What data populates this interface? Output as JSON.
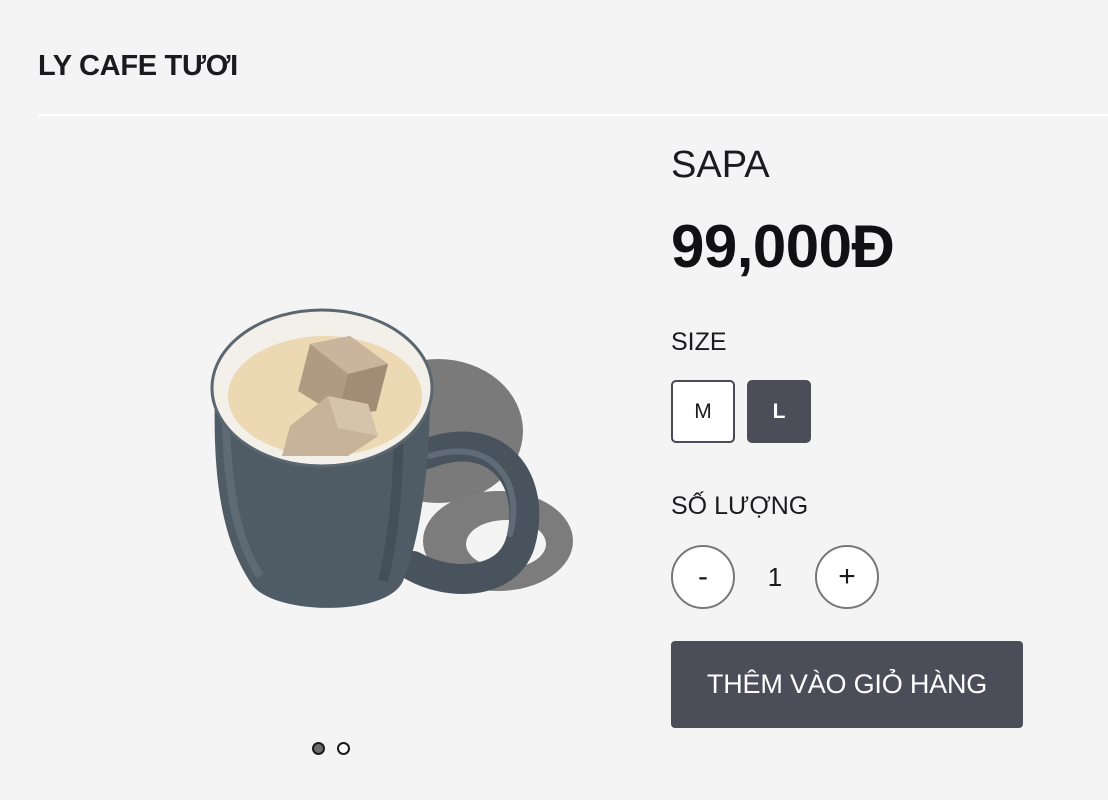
{
  "header": {
    "title": "LY CAFE TƯƠI"
  },
  "gallery": {
    "image_subject": "iced-coffee-in-gray-mug",
    "slide_count": 2,
    "active_slide": 1
  },
  "product": {
    "name": "SAPA",
    "price": "99,000Đ"
  },
  "size": {
    "label": "SIZE",
    "options": [
      "M",
      "L"
    ],
    "selected": "L"
  },
  "quantity": {
    "label": "SỐ LƯỢNG",
    "decrement_label": "-",
    "increment_label": "+",
    "value": "1"
  },
  "cart": {
    "add_label": "THÊM VÀO GIỎ HÀNG"
  },
  "colors": {
    "background": "#f4f4f4",
    "accent": "#4d4d59",
    "text": "#1b1b1f"
  }
}
